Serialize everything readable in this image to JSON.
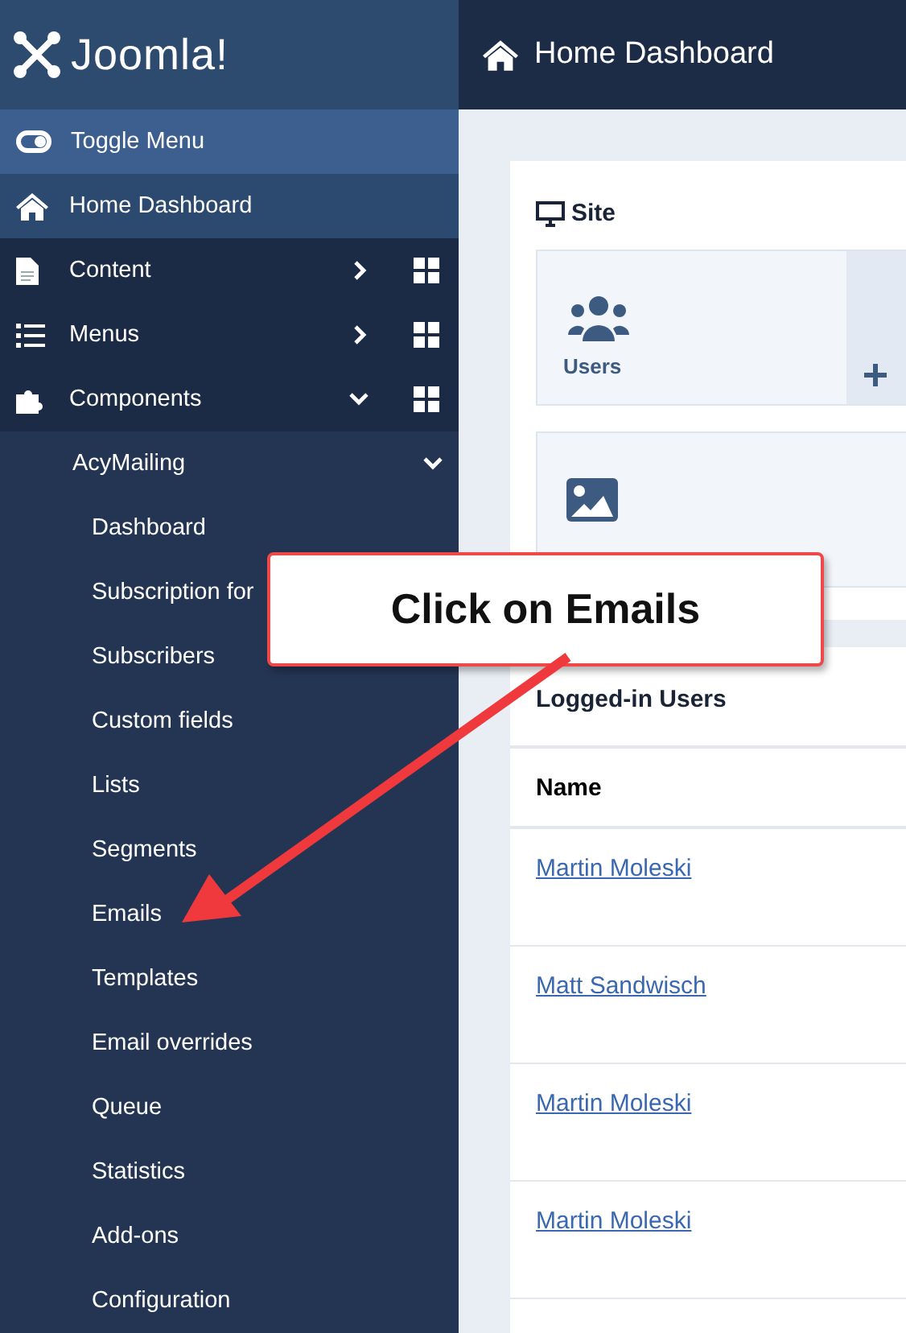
{
  "logo": {
    "text": "Joomla!"
  },
  "header": {
    "title": "Home Dashboard"
  },
  "sidebar": {
    "toggle": {
      "label": "Toggle Menu"
    },
    "home": {
      "label": "Home Dashboard",
      "selected": true
    },
    "menu": [
      {
        "label": "Content",
        "kind": "file",
        "expanded": false
      },
      {
        "label": "Menus",
        "kind": "list",
        "expanded": false
      },
      {
        "label": "Components",
        "kind": "puzzle",
        "expanded": true,
        "children": [
          {
            "label": "AcyMailing",
            "expanded": true,
            "children": [
              {
                "label": "Dashboard"
              },
              {
                "label": "Subscription for"
              },
              {
                "label": "Subscribers"
              },
              {
                "label": "Custom fields"
              },
              {
                "label": "Lists"
              },
              {
                "label": "Segments"
              },
              {
                "label": "Emails"
              },
              {
                "label": "Templates"
              },
              {
                "label": "Email overrides"
              },
              {
                "label": "Queue"
              },
              {
                "label": "Statistics"
              },
              {
                "label": "Add-ons"
              },
              {
                "label": "Configuration"
              }
            ]
          }
        ]
      }
    ]
  },
  "site_panel": {
    "title": "Site",
    "tiles": [
      {
        "kind": "users",
        "label": "Users",
        "add": true
      },
      {
        "kind": "media"
      }
    ]
  },
  "logged_in": {
    "title": "Logged-in Users",
    "columns": [
      "Name"
    ],
    "rows": [
      {
        "name": "Martin Moleski"
      },
      {
        "name": "Matt Sandwisch"
      },
      {
        "name": "Martin Moleski"
      },
      {
        "name": "Martin Moleski"
      }
    ]
  },
  "callout": {
    "text": "Click on Emails"
  }
}
